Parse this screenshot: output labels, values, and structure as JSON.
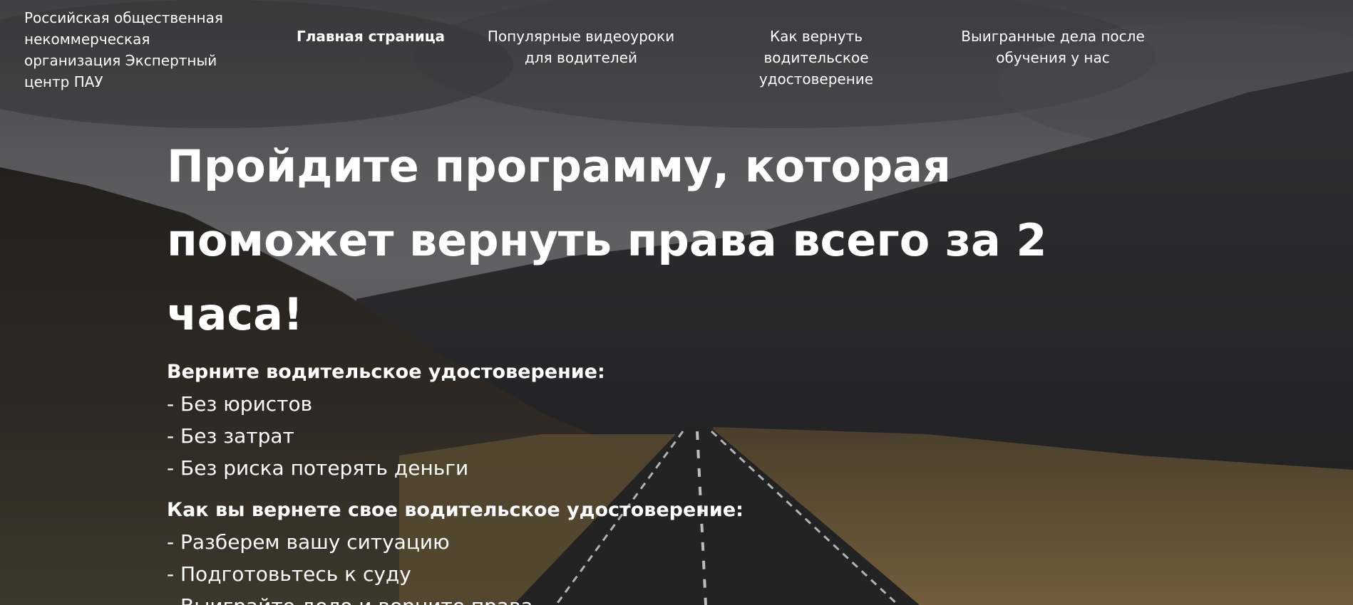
{
  "organization": {
    "name": "Российская общественная некоммерческая организация Экспертный центр ПАУ"
  },
  "nav": {
    "items": [
      {
        "label": "Главная страница",
        "active": true
      },
      {
        "label": "Популярные видеоуроки для водителей",
        "active": false
      },
      {
        "label": "Как вернуть водительское удостоверение",
        "active": false
      },
      {
        "label": "Выигранные дела после обучения у нас",
        "active": false
      }
    ]
  },
  "hero": {
    "headline": "Пройдите программу, которая поможет вернуть права всего за 2 часа!",
    "sections": [
      {
        "title": "Верните водительское удостоверение:",
        "items": [
          "- Без юристов",
          "- Без затрат",
          "- Без риска потерять деньги"
        ]
      },
      {
        "title": "Как вы вернете свое водительское удостоверение:",
        "items": [
          "- Разберем вашу ситуацию",
          "- Подготовьтесь к суду",
          "- Выиграйте дело и верните права"
        ]
      }
    ]
  },
  "colors": {
    "text": "#ffffff",
    "sky": "#6e6e70",
    "mountains": "#2e2d2c",
    "grass": "#8a7148",
    "road": "#2b2b2d"
  }
}
